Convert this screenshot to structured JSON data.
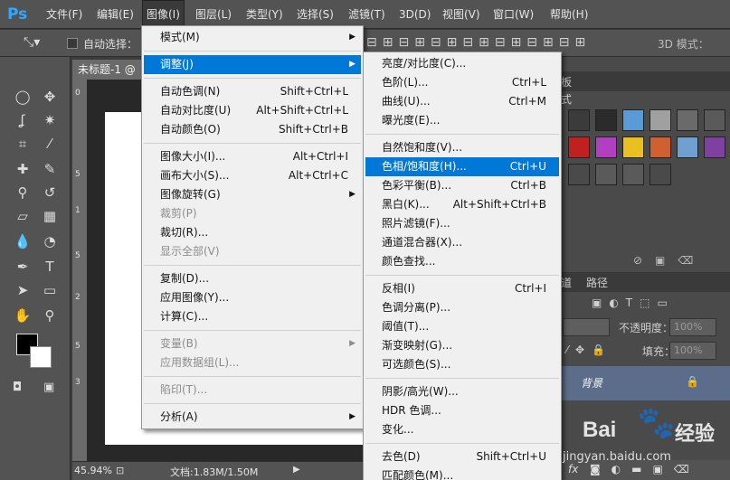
{
  "app": {
    "logo": "Ps"
  },
  "menubar": {
    "items": [
      "文件(F)",
      "编辑(E)",
      "图像(I)",
      "图层(L)",
      "类型(Y)",
      "选择(S)",
      "滤镜(T)",
      "3D(D)",
      "视图(V)",
      "窗口(W)",
      "帮助(H)"
    ],
    "active": "图像(I)"
  },
  "options_bar": {
    "auto_select_label": "自动选择：",
    "mode3d_label": "3D 模式："
  },
  "document": {
    "tab_title": "未标题-1 @",
    "ruler_ticks": [
      "0",
      "5",
      "1",
      "5",
      "2",
      "5",
      "3"
    ]
  },
  "status": {
    "zoom": "45.94%",
    "doc_size": "文档:1.83M/1.50M"
  },
  "styles_panel": {
    "tab_partial": "式",
    "tab_partial2": "板"
  },
  "layers_panel": {
    "tab_partial": "道",
    "tab_paths": "路径",
    "opacity_label": "不透明度：",
    "opacity_value": "100%",
    "fill_label": "填充：",
    "fill_value": "100%",
    "bg_layer_name": "背景",
    "fx_label": "fx"
  },
  "image_menu": {
    "items": [
      {
        "label": "模式(M)",
        "submenu": true
      },
      {
        "separator": true
      },
      {
        "label": "调整(J)",
        "submenu": true,
        "highlight": true
      },
      {
        "separator": true
      },
      {
        "label": "自动色调(N)",
        "shortcut": "Shift+Ctrl+L"
      },
      {
        "label": "自动对比度(U)",
        "shortcut": "Alt+Shift+Ctrl+L"
      },
      {
        "label": "自动颜色(O)",
        "shortcut": "Shift+Ctrl+B"
      },
      {
        "separator": true
      },
      {
        "label": "图像大小(I)...",
        "shortcut": "Alt+Ctrl+I"
      },
      {
        "label": "画布大小(S)...",
        "shortcut": "Alt+Ctrl+C"
      },
      {
        "label": "图像旋转(G)",
        "submenu": true
      },
      {
        "label": "裁剪(P)",
        "disabled": true
      },
      {
        "label": "裁切(R)..."
      },
      {
        "label": "显示全部(V)",
        "disabled": true
      },
      {
        "separator": true
      },
      {
        "label": "复制(D)..."
      },
      {
        "label": "应用图像(Y)..."
      },
      {
        "label": "计算(C)..."
      },
      {
        "separator": true
      },
      {
        "label": "变量(B)",
        "submenu": true,
        "disabled": true
      },
      {
        "label": "应用数据组(L)...",
        "disabled": true
      },
      {
        "separator": true
      },
      {
        "label": "陷印(T)...",
        "disabled": true
      },
      {
        "separator": true
      },
      {
        "label": "分析(A)",
        "submenu": true
      }
    ]
  },
  "adjust_menu": {
    "items": [
      {
        "label": "亮度/对比度(C)..."
      },
      {
        "label": "色阶(L)...",
        "shortcut": "Ctrl+L"
      },
      {
        "label": "曲线(U)...",
        "shortcut": "Ctrl+M"
      },
      {
        "label": "曝光度(E)..."
      },
      {
        "separator": true
      },
      {
        "label": "自然饱和度(V)..."
      },
      {
        "label": "色相/饱和度(H)...",
        "shortcut": "Ctrl+U",
        "highlight": true
      },
      {
        "label": "色彩平衡(B)...",
        "shortcut": "Ctrl+B"
      },
      {
        "label": "黑白(K)...",
        "shortcut": "Alt+Shift+Ctrl+B"
      },
      {
        "label": "照片滤镜(F)..."
      },
      {
        "label": "通道混合器(X)..."
      },
      {
        "label": "颜色查找..."
      },
      {
        "separator": true
      },
      {
        "label": "反相(I)",
        "shortcut": "Ctrl+I"
      },
      {
        "label": "色调分离(P)..."
      },
      {
        "label": "阈值(T)..."
      },
      {
        "label": "渐变映射(G)..."
      },
      {
        "label": "可选颜色(S)..."
      },
      {
        "separator": true
      },
      {
        "label": "阴影/高光(W)..."
      },
      {
        "label": "HDR 色调..."
      },
      {
        "label": "变化..."
      },
      {
        "separator": true
      },
      {
        "label": "去色(D)",
        "shortcut": "Shift+Ctrl+U"
      },
      {
        "label": "匹配颜色(M)..."
      }
    ]
  },
  "watermark": {
    "brand_left": "Bai",
    "brand_right": "经验",
    "url": "jingyan.baidu.com"
  },
  "colors": {
    "highlight": "#0078d7",
    "menu_bg": "#f0f0f0",
    "chrome": "#535353",
    "layer_selected": "#5b6d8a"
  },
  "style_swatches": [
    "#3b3b3b",
    "#2b2b2b",
    "#5a9bd5",
    "#a0a0a0",
    "#6a6a6a",
    "#5a5a5a",
    "#c02020",
    "#b040c0",
    "#e8c020",
    "#d06030",
    "#70a0d0",
    "#8040a0",
    "#4a4a4a",
    "#5a5a5a",
    "#5a5a5a",
    "#4a4a4a"
  ]
}
